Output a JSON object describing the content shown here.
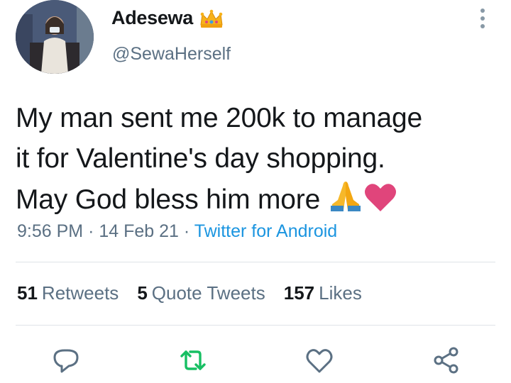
{
  "user": {
    "name": "Adesewa",
    "handle": "@SewaHerself",
    "name_emoji_icon": "crown-icon"
  },
  "tweet": {
    "line1": "My man sent me 200k to manage",
    "line2": "it for Valentine's day shopping.",
    "line3": "May God bless him more ",
    "emoji_icons": [
      "folded-hands-icon",
      "heart-icon"
    ],
    "time": "9:56 PM",
    "date": "14 Feb 21",
    "separator": "·",
    "source": "Twitter for Android"
  },
  "stats": {
    "retweets_count": "51",
    "retweets_label": "Retweets",
    "quotes_count": "5",
    "quotes_label": "Quote Tweets",
    "likes_count": "157",
    "likes_label": "Likes"
  },
  "actions": [
    "reply-icon",
    "retweet-icon",
    "like-icon",
    "share-icon"
  ],
  "colors": {
    "text": "#14171a",
    "secondary": "#5b7083",
    "link": "#1b95e0",
    "retweet_green": "#17bf63",
    "heart_pink": "#e0457b",
    "divider": "#dfe3e8"
  }
}
